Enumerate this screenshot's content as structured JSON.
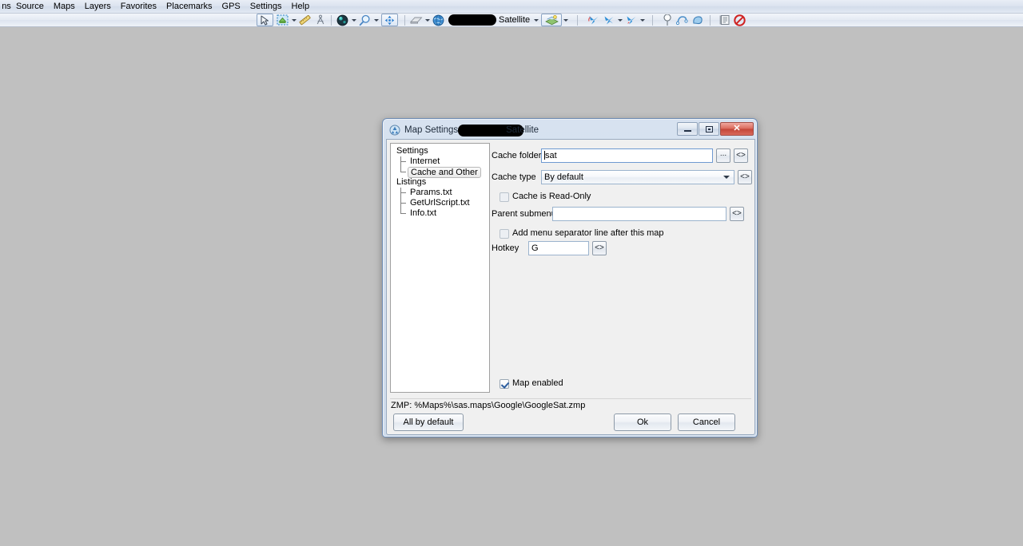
{
  "menubar": {
    "items": [
      {
        "label": "Operations",
        "clipped": true
      },
      {
        "label": "Source",
        "clipped": false
      },
      {
        "label": "Maps",
        "clipped": false
      },
      {
        "label": "Layers",
        "clipped": false
      },
      {
        "label": "Favorites",
        "clipped": false
      },
      {
        "label": "Placemarks",
        "clipped": false
      },
      {
        "label": "GPS",
        "clipped": false
      },
      {
        "label": "Settings",
        "clipped": false
      },
      {
        "label": "Help",
        "clipped": false
      }
    ]
  },
  "toolbar": {
    "map_label": "Satellite",
    "buttons": [
      {
        "name": "pointer-tool",
        "icon": "cursor-arrow"
      },
      {
        "name": "selection-tool",
        "icon": "selection-rect"
      },
      {
        "name": "ruler-tool",
        "icon": "ruler"
      },
      {
        "name": "compass-tool",
        "icon": "compass"
      },
      {
        "name": "globe-view",
        "icon": "globe-dark"
      },
      {
        "name": "zoom-tool",
        "icon": "magnifier"
      },
      {
        "name": "fit-to-screen",
        "icon": "fullscreen-arrows"
      },
      {
        "name": "eraser-tool",
        "icon": "eraser"
      },
      {
        "name": "map-source",
        "icon": "globe-blue"
      },
      {
        "name": "layer-select",
        "icon": "layers-stack"
      },
      {
        "name": "nav-tool-1",
        "icon": "pinwheel-red-blue"
      },
      {
        "name": "nav-tool-2",
        "icon": "pinwheel-blue"
      },
      {
        "name": "nav-tool-3",
        "icon": "pinwheel-blue-2"
      },
      {
        "name": "placemark-tool",
        "icon": "balloon-pin"
      },
      {
        "name": "path-tool",
        "icon": "path-curve"
      },
      {
        "name": "polygon-tool",
        "icon": "polygon-shape"
      },
      {
        "name": "list-view",
        "icon": "list-panel"
      },
      {
        "name": "cancel-operation",
        "icon": "no-entry"
      }
    ]
  },
  "dialog": {
    "title_prefix": "Map Settings",
    "title_suffix": "Satellite",
    "icon": "map-settings-icon",
    "window_controls": {
      "minimize": "minimize-button",
      "maximize": "maximize-button",
      "close": "close-button",
      "close_glyph": "✕"
    },
    "tree": {
      "nodes": [
        {
          "label": "Settings",
          "level": 0,
          "selected": false,
          "last": false
        },
        {
          "label": "Internet",
          "level": 1,
          "selected": false,
          "last": false
        },
        {
          "label": "Cache and Other",
          "level": 1,
          "selected": true,
          "last": true
        },
        {
          "label": "Listings",
          "level": 0,
          "selected": false,
          "last": false
        },
        {
          "label": "Params.txt",
          "level": 1,
          "selected": false,
          "last": false
        },
        {
          "label": "GetUrlScript.txt",
          "level": 1,
          "selected": false,
          "last": false
        },
        {
          "label": "Info.txt",
          "level": 1,
          "selected": false,
          "last": true
        }
      ]
    },
    "form": {
      "cache_folder_label": "Cache folder",
      "cache_folder_value": "sat",
      "cache_folder_placeholder": "",
      "browse_button_label": "...",
      "code_button_label": "<>",
      "cache_type_label": "Cache type",
      "cache_type_value": "By default",
      "cache_type_code_label": "<>",
      "cache_readonly_label": "Cache is Read-Only",
      "cache_readonly_checked": false,
      "parent_submenu_label": "Parent submenu",
      "parent_submenu_value": "",
      "parent_submenu_code_label": "<>",
      "separator_label": "Add menu separator line after this map",
      "separator_checked": false,
      "hotkey_label": "Hotkey",
      "hotkey_value": "G",
      "hotkey_code_label": "<>",
      "map_enabled_label": "Map enabled",
      "map_enabled_checked": true
    },
    "status": "ZMP:  %Maps%\\sas.maps\\Google\\GoogleSat.zmp",
    "buttons": {
      "all_by_default": "All by default",
      "ok": "Ok",
      "cancel": "Cancel"
    }
  },
  "colors": {
    "desktop": "#c0c0c0",
    "menubar_top": "#e9eef6",
    "dialog_frame": "#d7e2f0",
    "dialog_body": "#f0f0f0",
    "close_button": "#c34538",
    "accent_blue": "#2b5c9e"
  }
}
